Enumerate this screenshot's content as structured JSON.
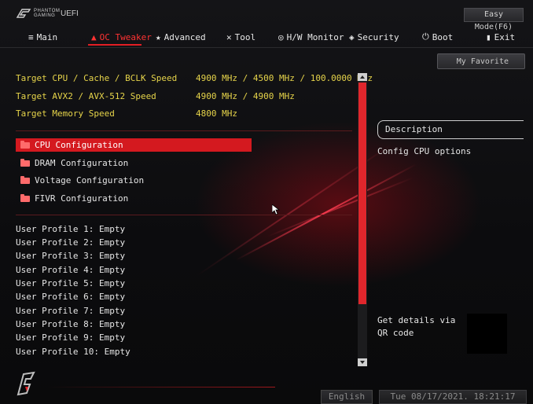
{
  "header": {
    "brand": "PHANTOM GAMING",
    "title": "UEFI",
    "easy_mode": "Easy Mode(F6)"
  },
  "nav": {
    "tabs": [
      {
        "label": "Main",
        "icon": "list-icon",
        "active": false
      },
      {
        "label": "OC Tweaker",
        "icon": "flame-icon",
        "active": true
      },
      {
        "label": "Advanced",
        "icon": "star-icon",
        "active": false
      },
      {
        "label": "Tool",
        "icon": "wrench-icon",
        "active": false
      },
      {
        "label": "H/W Monitor",
        "icon": "gauge-icon",
        "active": false
      },
      {
        "label": "Security",
        "icon": "shield-icon",
        "active": false
      },
      {
        "label": "Boot",
        "icon": "power-icon",
        "active": false
      },
      {
        "label": "Exit",
        "icon": "door-icon",
        "active": false
      }
    ]
  },
  "targets": [
    {
      "label": "Target CPU / Cache / BCLK Speed",
      "value": "4900 MHz / 4500 MHz / 100.0000 MHz"
    },
    {
      "label": "Target AVX2 / AVX-512 Speed",
      "value": "4900 MHz / 4900 MHz"
    },
    {
      "label": "Target Memory Speed",
      "value": "4800 MHz"
    }
  ],
  "menu": [
    {
      "label": "CPU Configuration",
      "selected": true
    },
    {
      "label": "DRAM Configuration",
      "selected": false
    },
    {
      "label": "Voltage Configuration",
      "selected": false
    },
    {
      "label": "FIVR Configuration",
      "selected": false
    }
  ],
  "profiles": [
    "User Profile 1: Empty",
    "User Profile 2: Empty",
    "User Profile 3: Empty",
    "User Profile 4: Empty",
    "User Profile 5: Empty",
    "User Profile 6: Empty",
    "User Profile 7: Empty",
    "User Profile 8: Empty",
    "User Profile 9: Empty",
    "User Profile 10: Empty"
  ],
  "sidebar": {
    "favorite": "My Favorite",
    "description_title": "Description",
    "description_text": "Config CPU options",
    "qr_text": "Get details via QR code"
  },
  "footer": {
    "language": "English",
    "datetime": "Tue 08/17/2021. 18:21:17"
  },
  "colors": {
    "accent": "#e31e24",
    "target_text": "#e6d44a"
  }
}
